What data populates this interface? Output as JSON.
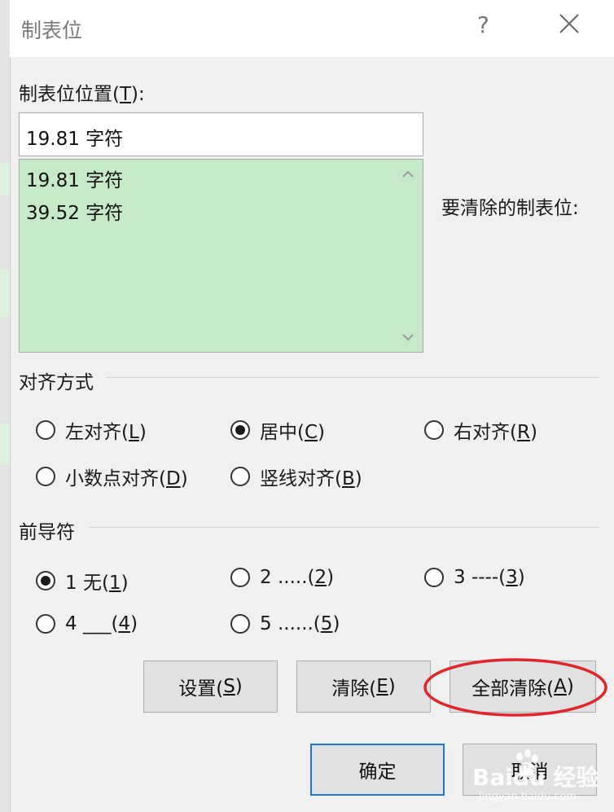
{
  "dialog": {
    "title": "制表位",
    "help_label": "?",
    "close_label": "×"
  },
  "tab_position": {
    "label_prefix": "制表位位置(",
    "label_key": "T",
    "label_suffix": "):",
    "value": "19.81 字符",
    "items": [
      "19.81 字符",
      "39.52 字符"
    ]
  },
  "clear_label": "要清除的制表位:",
  "alignment": {
    "title": "对齐方式",
    "options": [
      {
        "prefix": "左对齐(",
        "key": "L",
        "suffix": ")",
        "selected": false
      },
      {
        "prefix": "居中(",
        "key": "C",
        "suffix": ")",
        "selected": true
      },
      {
        "prefix": "右对齐(",
        "key": "R",
        "suffix": ")",
        "selected": false
      },
      {
        "prefix": "小数点对齐(",
        "key": "D",
        "suffix": ")",
        "selected": false
      },
      {
        "prefix": "竖线对齐(",
        "key": "B",
        "suffix": ")",
        "selected": false
      }
    ]
  },
  "leader": {
    "title": "前导符",
    "options": [
      {
        "prefix": "1 无(",
        "key": "1",
        "suffix": ")",
        "selected": true
      },
      {
        "prefix": "2 .....(",
        "key": "2",
        "suffix": ")",
        "selected": false
      },
      {
        "prefix": "3 ----(",
        "key": "3",
        "suffix": ")",
        "selected": false
      },
      {
        "prefix": "4 ___(",
        "key": "4",
        "suffix": ")",
        "selected": false
      },
      {
        "prefix": "5 ......(",
        "key": "5",
        "suffix": ")",
        "selected": false
      }
    ]
  },
  "buttons": {
    "set": {
      "prefix": "设置(",
      "key": "S",
      "suffix": ")"
    },
    "clear": {
      "prefix": "清除(",
      "key": "E",
      "suffix": ")"
    },
    "clear_all": {
      "prefix": "全部清除(",
      "key": "A",
      "suffix": ")"
    },
    "ok": "确定",
    "cancel": "取消"
  },
  "watermark": {
    "brand": "Baidu 经验",
    "url": "jingyan.baidu.com"
  },
  "colors": {
    "list_bg": "#c6e9c7",
    "default_border": "#1b79d1",
    "annotation": "#e0262b"
  }
}
